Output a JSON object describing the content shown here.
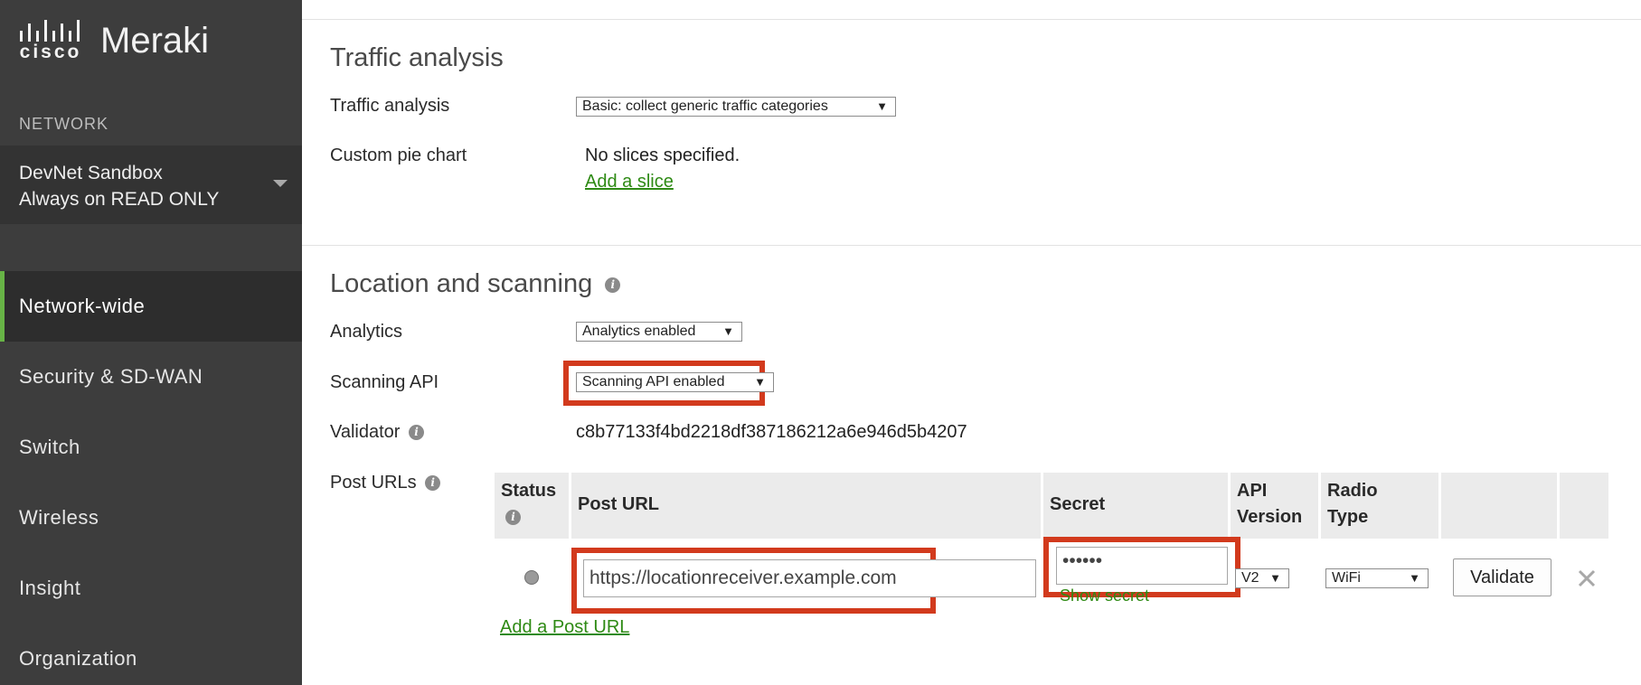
{
  "brand": {
    "cisco": "cisco",
    "meraki": "Meraki"
  },
  "sidebar": {
    "network_heading": "NETWORK",
    "network_name": "DevNet Sandbox",
    "network_sub": "Always on READ ONLY",
    "items": [
      {
        "label": "Network-wide",
        "active": true
      },
      {
        "label": "Security & SD-WAN"
      },
      {
        "label": "Switch"
      },
      {
        "label": "Wireless"
      },
      {
        "label": "Insight"
      },
      {
        "label": "Organization"
      }
    ]
  },
  "traffic": {
    "title": "Traffic analysis",
    "analysis_label": "Traffic analysis",
    "analysis_value": "Basic: collect generic traffic categories",
    "pie_label": "Custom pie chart",
    "pie_text": "No slices specified.",
    "add_slice": "Add a slice"
  },
  "location": {
    "title": "Location and scanning",
    "analytics_label": "Analytics",
    "analytics_value": "Analytics enabled",
    "scanning_label": "Scanning API",
    "scanning_value": "Scanning API enabled",
    "validator_label": "Validator",
    "validator_value": "c8b77133f4bd2218df387186212a6e946d5b4207",
    "post_urls_label": "Post URLs",
    "table": {
      "headers": {
        "status": "Status",
        "post_url": "Post URL",
        "secret": "Secret",
        "api_version_1": "API",
        "api_version_2": "Version",
        "radio_type_1": "Radio",
        "radio_type_2": "Type"
      },
      "row": {
        "post_url": "https://locationreceiver.example.com",
        "secret": "••••••",
        "show_secret": "Show secret",
        "api_version": "V2",
        "radio_type": "WiFi",
        "validate": "Validate"
      }
    },
    "add_post_url": "Add a Post URL"
  },
  "icons": {
    "info": "info-icon",
    "remove": "close-icon",
    "status": "status-dot-icon",
    "caret": "chevron-down-icon"
  },
  "colors": {
    "sidebar_bg": "#3d3d3d",
    "active_accent": "#67b346",
    "link": "#2e8a14",
    "highlight": "#d23a1d"
  }
}
